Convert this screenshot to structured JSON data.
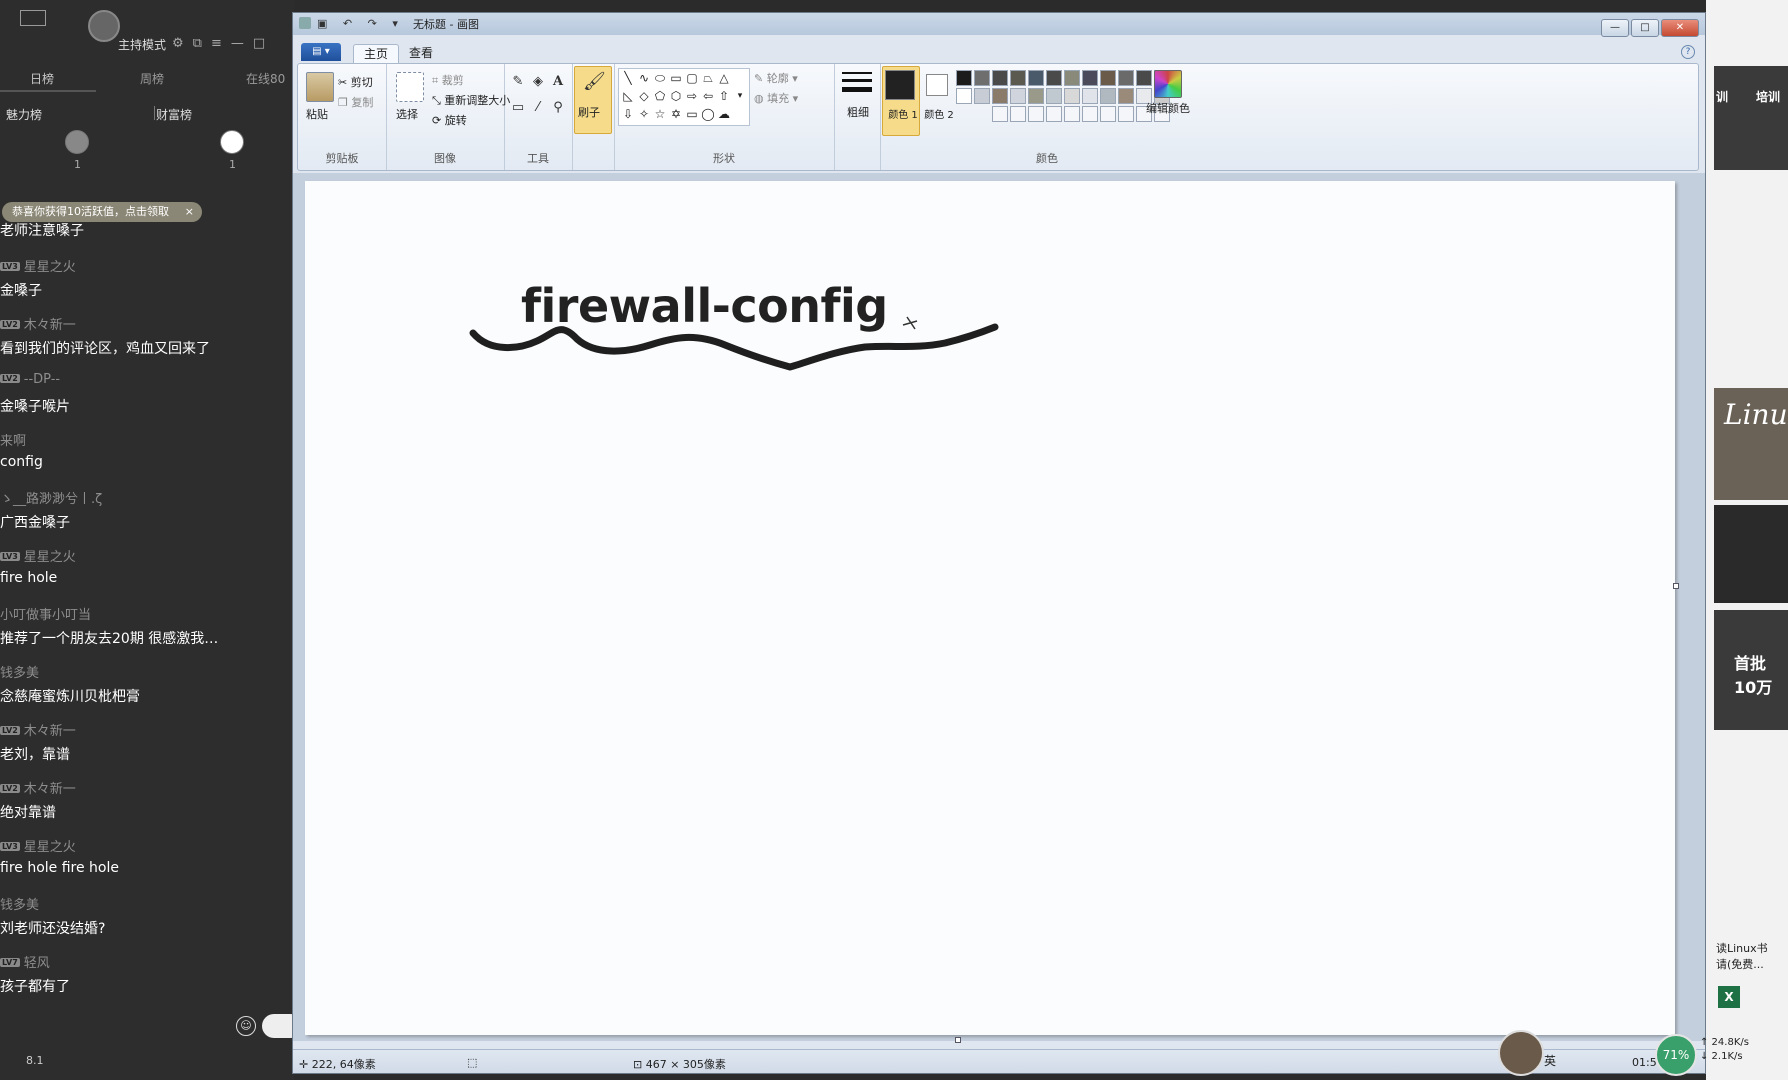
{
  "chat": {
    "host_mode": "主持模式",
    "tabs": [
      "日榜",
      "周榜",
      "在线80"
    ],
    "rank_heads": [
      "魅力榜",
      "财富榜"
    ],
    "rank_nums": [
      "1",
      "1"
    ],
    "notice": "恭喜你获得10活跃值，点击领取",
    "notice_close": "×",
    "messages": [
      {
        "user": "",
        "level": "",
        "text": "老师注意嗓子"
      },
      {
        "user": "星星之火",
        "level": "LV3",
        "text": "金嗓子"
      },
      {
        "user": "木々新一",
        "level": "LV2",
        "text": "看到我们的评论区，鸡血又回来了"
      },
      {
        "user": "--DP--",
        "level": "LV2",
        "text": "金嗓子喉片"
      },
      {
        "user": "来啊",
        "level": "",
        "text": "config"
      },
      {
        "user": "ゝ__路渺渺兮丨.ζ",
        "level": "",
        "text": "广西金嗓子"
      },
      {
        "user": "星星之火",
        "level": "LV3",
        "text": "fire  hole"
      },
      {
        "user": "小叮做事小叮当",
        "level": "",
        "text": "推荐了一个朋友去20期 很感激我…"
      },
      {
        "user": "钱多美",
        "level": "",
        "text": "念慈庵蜜炼川贝枇杷膏"
      },
      {
        "user": "木々新一",
        "level": "LV2",
        "text": "老刘，靠谱"
      },
      {
        "user": "木々新一",
        "level": "LV2",
        "text": "绝对靠谱"
      },
      {
        "user": "星星之火",
        "level": "LV3",
        "text": "fire hole  fire hole"
      },
      {
        "user": "钱多美",
        "level": "",
        "text": "刘老师还没结婚?"
      },
      {
        "user": "轻风",
        "level": "LV7",
        "text": "孩子都有了"
      }
    ],
    "bottom_num": "8.1"
  },
  "paint": {
    "title": "无标题 - 画图",
    "quick_access": "▣ ↶ ↷ ▾",
    "window_buttons": [
      "—",
      "□",
      "✕"
    ],
    "file_menu": "▤ ▾",
    "tabs": [
      "主页",
      "查看"
    ],
    "groups": {
      "clipboard": {
        "label": "剪贴板",
        "paste": "粘贴",
        "cut": "剪切",
        "copy": "复制"
      },
      "image": {
        "label": "图像",
        "select": "选择",
        "crop": "裁剪",
        "resize": "重新调整大小",
        "rotate": "旋转"
      },
      "tools": {
        "label": "工具"
      },
      "brushes": {
        "label": "刷子"
      },
      "shapes": {
        "label": "形状",
        "outline": "轮廓",
        "fill": "填充"
      },
      "size": {
        "label": "粗细"
      },
      "colors": {
        "label": "颜色",
        "color1": "颜色 1",
        "color2": "颜色 2",
        "edit": "编辑颜色"
      }
    },
    "canvas_text": "firewall-config",
    "status": {
      "cursor_pos": "222, 64像素",
      "selection_size": "467 × 305像素"
    },
    "colors": {
      "color1": "#222222",
      "color2": "#ffffff",
      "palette": [
        "#1c1c1c",
        "#6e6e6e",
        "#4a4a4a",
        "#5a5a50",
        "#4a5a6a",
        "#4a4a4a",
        "#8a8a7a",
        "#4a4a5a",
        "#6a5a4a",
        "#6a6a6a",
        "#4a4a4a",
        "#4a4a4a",
        "#ffffff",
        "#c8ccd4",
        "#8a7a6a",
        "#d0d4dc",
        "#9a9a8a",
        "#c0c8d0",
        "#d8d8d8",
        "#e0e4ea",
        "#b0b8c0",
        "#9a8a7a",
        "#e8eaee",
        "#cccccc"
      ]
    }
  },
  "right": {
    "label1": "训",
    "label2": "培训",
    "ad_title": "Linux",
    "promo": "首批10万",
    "caption1": "读Linux书",
    "caption2": "请(免费..."
  },
  "tray": {
    "ime": "英",
    "gauge": "71%",
    "speed_up": "↑ 24.8K/s",
    "speed_down": "↓ 2.1K/s",
    "clock": "01:5"
  }
}
